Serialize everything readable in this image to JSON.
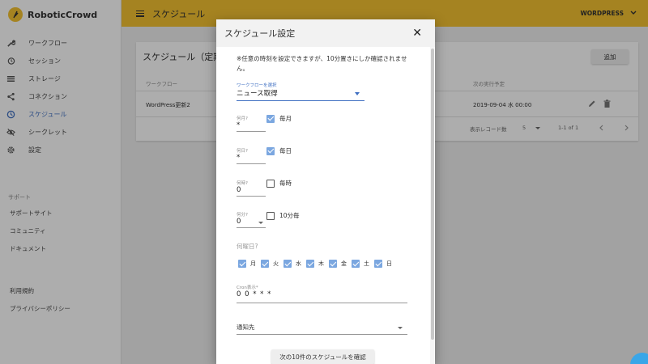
{
  "app": {
    "brand": "RoboticCrowd",
    "accent": "#f3c232",
    "active_color": "#3f6fc2"
  },
  "header": {
    "title": "スケジュール",
    "workspace": "WORDPRESS"
  },
  "sidebar": {
    "items": [
      {
        "label": "ワークフロー",
        "icon": "wrench-icon"
      },
      {
        "label": "セッション",
        "icon": "history-icon"
      },
      {
        "label": "ストレージ",
        "icon": "list-icon"
      },
      {
        "label": "コネクション",
        "icon": "share-icon"
      },
      {
        "label": "スケジュール",
        "icon": "clock-icon"
      },
      {
        "label": "シークレット",
        "icon": "eye-off-icon"
      },
      {
        "label": "設定",
        "icon": "gear-icon"
      }
    ],
    "support_heading": "サポート",
    "support_items": [
      "サポートサイト",
      "コミュニティ",
      "ドキュメント"
    ],
    "legal_items": [
      "利用規約",
      "プライバシーポリシー"
    ]
  },
  "main": {
    "title": "スケジュール（定期",
    "add_button": "追加",
    "columns": {
      "workflow": "ワークフロー",
      "next_run": "次の実行予定"
    },
    "row": {
      "workflow": "WordPress更新2",
      "next_run": "2019-09-04 水 00:00"
    },
    "footer": {
      "rows_label": "表示レコード数",
      "rows_value": "5",
      "range": "1-1 of 1"
    }
  },
  "modal": {
    "title": "スケジュール設定",
    "note": "※任意の時刻を設定できますが、10分置きにしか確認されません。",
    "workflow_label": "ワークフローを選択",
    "workflow_value": "ニュース取得",
    "month": {
      "label": "何月?",
      "value": "*",
      "check_label": "毎月",
      "checked": true
    },
    "day": {
      "label": "何日?",
      "value": "*",
      "check_label": "毎日",
      "checked": true
    },
    "hour": {
      "label": "何時?",
      "value": "0",
      "check_label": "毎時",
      "checked": false
    },
    "minute": {
      "label": "何分?",
      "value": "0",
      "check_label": "10分毎",
      "checked": false
    },
    "weekdays_label": "何曜日?",
    "weekdays": [
      {
        "label": "月",
        "checked": true
      },
      {
        "label": "火",
        "checked": true
      },
      {
        "label": "水",
        "checked": true
      },
      {
        "label": "木",
        "checked": true
      },
      {
        "label": "金",
        "checked": true
      },
      {
        "label": "土",
        "checked": true
      },
      {
        "label": "日",
        "checked": true
      }
    ],
    "cron_label": "Cron表示*",
    "cron_value": "0 0 * * *",
    "notify_label": "通知先",
    "confirm_button": "次の10件のスケジュールを確認"
  }
}
